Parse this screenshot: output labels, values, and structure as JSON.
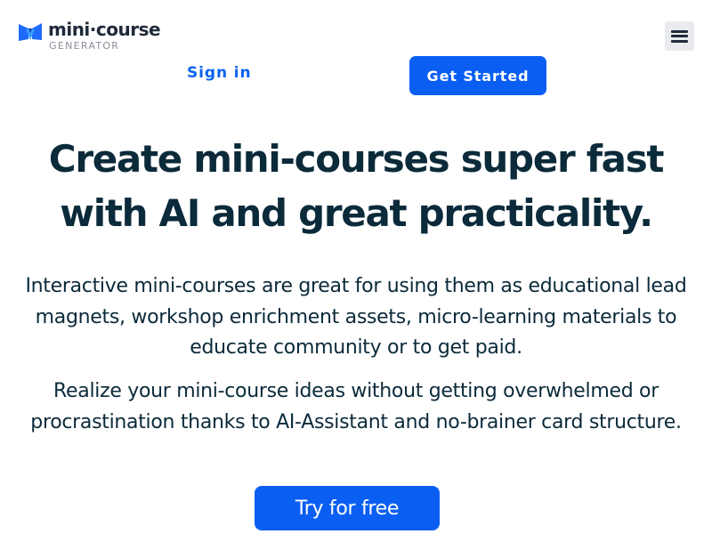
{
  "header": {
    "logo_name": "mini·course",
    "logo_subtitle": "GENERATOR",
    "logo_icon": "bowtie-logo-icon",
    "menu_icon": "hamburger-menu-icon",
    "signin_label": "Sign in",
    "get_started_label": "Get Started"
  },
  "hero": {
    "title": "Create mini-courses super fast with AI and great practicality.",
    "description_1": "Interactive mini-courses are great for using them as educational lead magnets, workshop enrichment assets, micro-learning materials to educate community or to get paid.",
    "description_2": "Realize your mini-course ideas without getting overwhelmed or procrastination thanks to AI-Assistant and no-brainer card structure.",
    "cta_label": "Try for free"
  },
  "colors": {
    "accent": "#0a5ff2",
    "heading": "#0b2a3a",
    "logo_blue": "#1f6bff",
    "logo_light_blue": "#3aa0ff"
  }
}
